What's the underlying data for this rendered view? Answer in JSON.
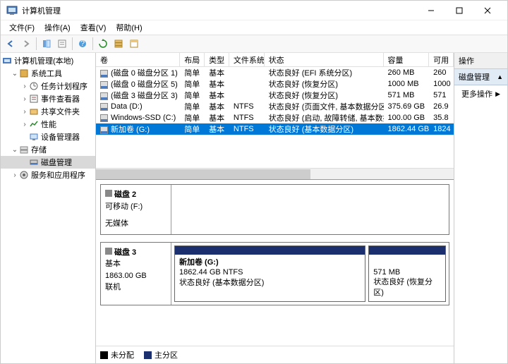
{
  "window": {
    "title": "计算机管理"
  },
  "menu": {
    "file": "文件(F)",
    "action": "操作(A)",
    "view": "查看(V)",
    "help": "帮助(H)"
  },
  "tree": {
    "root": "计算机管理(本地)",
    "systemTools": "系统工具",
    "taskScheduler": "任务计划程序",
    "eventViewer": "事件查看器",
    "sharedFolders": "共享文件夹",
    "performance": "性能",
    "deviceManager": "设备管理器",
    "storage": "存储",
    "diskMgmt": "磁盘管理",
    "services": "服务和应用程序"
  },
  "columns": {
    "name": "卷",
    "layout": "布局",
    "type": "类型",
    "fs": "文件系统",
    "status": "状态",
    "cap": "容量",
    "avail": "可用"
  },
  "vols": [
    {
      "name": "(磁盘 0 磁盘分区 1)",
      "layout": "简单",
      "type": "基本",
      "fs": "",
      "status": "状态良好 (EFI 系统分区)",
      "cap": "260 MB",
      "avail": "260"
    },
    {
      "name": "(磁盘 0 磁盘分区 5)",
      "layout": "简单",
      "type": "基本",
      "fs": "",
      "status": "状态良好 (恢复分区)",
      "cap": "1000 MB",
      "avail": "1000"
    },
    {
      "name": "(磁盘 3 磁盘分区 3)",
      "layout": "简单",
      "type": "基本",
      "fs": "",
      "status": "状态良好 (恢复分区)",
      "cap": "571 MB",
      "avail": "571"
    },
    {
      "name": "Data (D:)",
      "layout": "简单",
      "type": "基本",
      "fs": "NTFS",
      "status": "状态良好 (页面文件, 基本数据分区)",
      "cap": "375.69 GB",
      "avail": "26.9"
    },
    {
      "name": "Windows-SSD (C:)",
      "layout": "简单",
      "type": "基本",
      "fs": "NTFS",
      "status": "状态良好 (启动, 故障转储, 基本数据分区)",
      "cap": "100.00 GB",
      "avail": "35.8"
    },
    {
      "name": "新加卷 (G:)",
      "layout": "简单",
      "type": "基本",
      "fs": "NTFS",
      "status": "状态良好 (基本数据分区)",
      "cap": "1862.44 GB",
      "avail": "1824"
    }
  ],
  "disk2": {
    "title": "磁盘 2",
    "removable": "可移动 (F:)",
    "nomedia": "无媒体"
  },
  "disk3": {
    "title": "磁盘 3",
    "type": "基本",
    "size": "1863.00 GB",
    "state": "联机",
    "p1": {
      "title": "新加卷  (G:)",
      "line2": "1862.44 GB NTFS",
      "line3": "状态良好 (基本数据分区)"
    },
    "p2": {
      "line1": "571 MB",
      "line2": "状态良好 (恢复分区)"
    }
  },
  "legend": {
    "unalloc": "未分配",
    "primary": "主分区"
  },
  "actions": {
    "header": "操作",
    "sub": "磁盘管理",
    "more": "更多操作"
  }
}
